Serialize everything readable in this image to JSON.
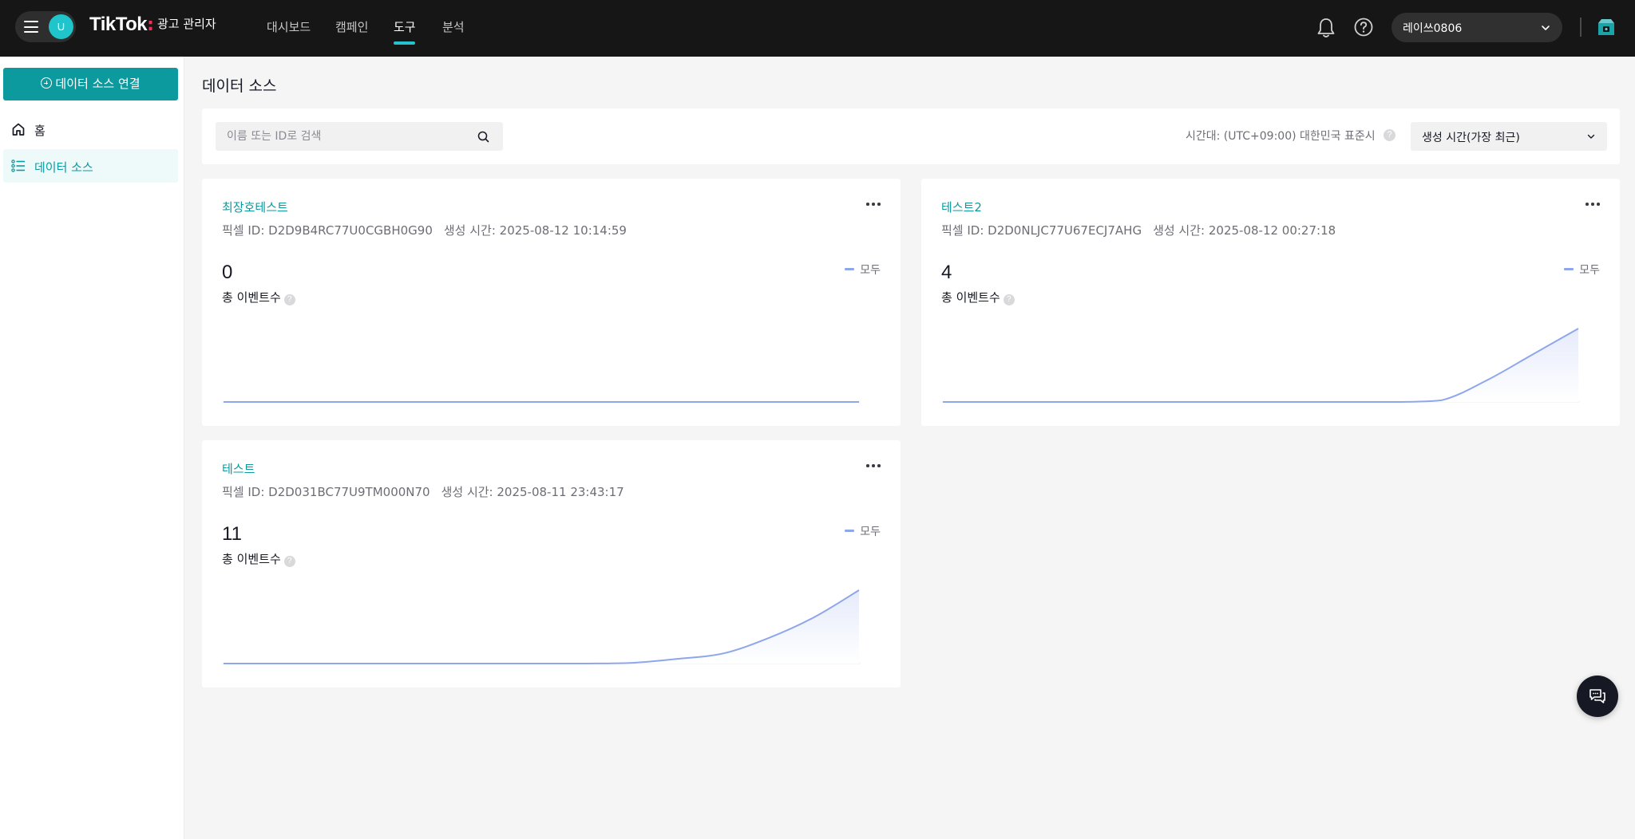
{
  "header": {
    "avatar_initial": "U",
    "brand_logo": "TikTok",
    "brand_colon": ":",
    "brand_sub": "광고 관리자",
    "nav": [
      {
        "label": "대시보드",
        "active": false
      },
      {
        "label": "캠페인",
        "active": false
      },
      {
        "label": "도구",
        "active": true
      },
      {
        "label": "분석",
        "active": false
      }
    ],
    "account_name": "레이쓰0806",
    "icons": [
      "menu-icon",
      "bell-icon",
      "help-icon",
      "chevron-down-icon",
      "store-icon"
    ]
  },
  "sidebar": {
    "connect_button": "데이터 소스 연결",
    "items": [
      {
        "label": "홈",
        "icon": "home-icon",
        "active": false
      },
      {
        "label": "데이터 소스",
        "icon": "list-icon",
        "active": true
      }
    ]
  },
  "main": {
    "title": "데이터 소스",
    "search_placeholder": "이름 또는 ID로 검색",
    "timezone": "시간대: (UTC+09:00) 대한민국 표준시",
    "timezone_help": "?",
    "sort_value": "생성 시간(가장 최근)",
    "cards": [
      {
        "name": "최장호테스트",
        "pixel_id": "픽셀 ID: D2D9B4RC77U0CGBH0G90",
        "created": "생성 시간: 2025-08-12 10:14:59",
        "count": "0",
        "count_label": "총 이벤트수",
        "legend": "모두",
        "trend": [
          0,
          0,
          0,
          0,
          0,
          0,
          0,
          0,
          0,
          0,
          0,
          0
        ]
      },
      {
        "name": "테스트2",
        "pixel_id": "픽셀 ID: D2D0NLJC77U67ECJ7AHG",
        "created": "생성 시간: 2025-08-12 00:27:18",
        "count": "4",
        "count_label": "총 이벤트수",
        "legend": "모두",
        "trend": [
          0,
          0,
          0,
          0,
          0,
          0,
          0,
          0,
          0,
          0,
          0,
          0.1,
          1.2,
          2.6,
          4
        ]
      },
      {
        "name": "테스트",
        "pixel_id": "픽셀 ID: D2D031BC77U9TM000N70",
        "created": "생성 시간: 2025-08-11 23:43:17",
        "count": "11",
        "count_label": "총 이벤트수",
        "legend": "모두",
        "trend": [
          0,
          0,
          0,
          0,
          0,
          0,
          0,
          0,
          0,
          0.1,
          0.7,
          1.5,
          3.8,
          6.9,
          11
        ]
      }
    ]
  },
  "colors": {
    "accent": "#0d9a9f",
    "topbar": "#161616",
    "chart_line": "#8ea6ec",
    "chart_fill": "#e6ebfb"
  }
}
